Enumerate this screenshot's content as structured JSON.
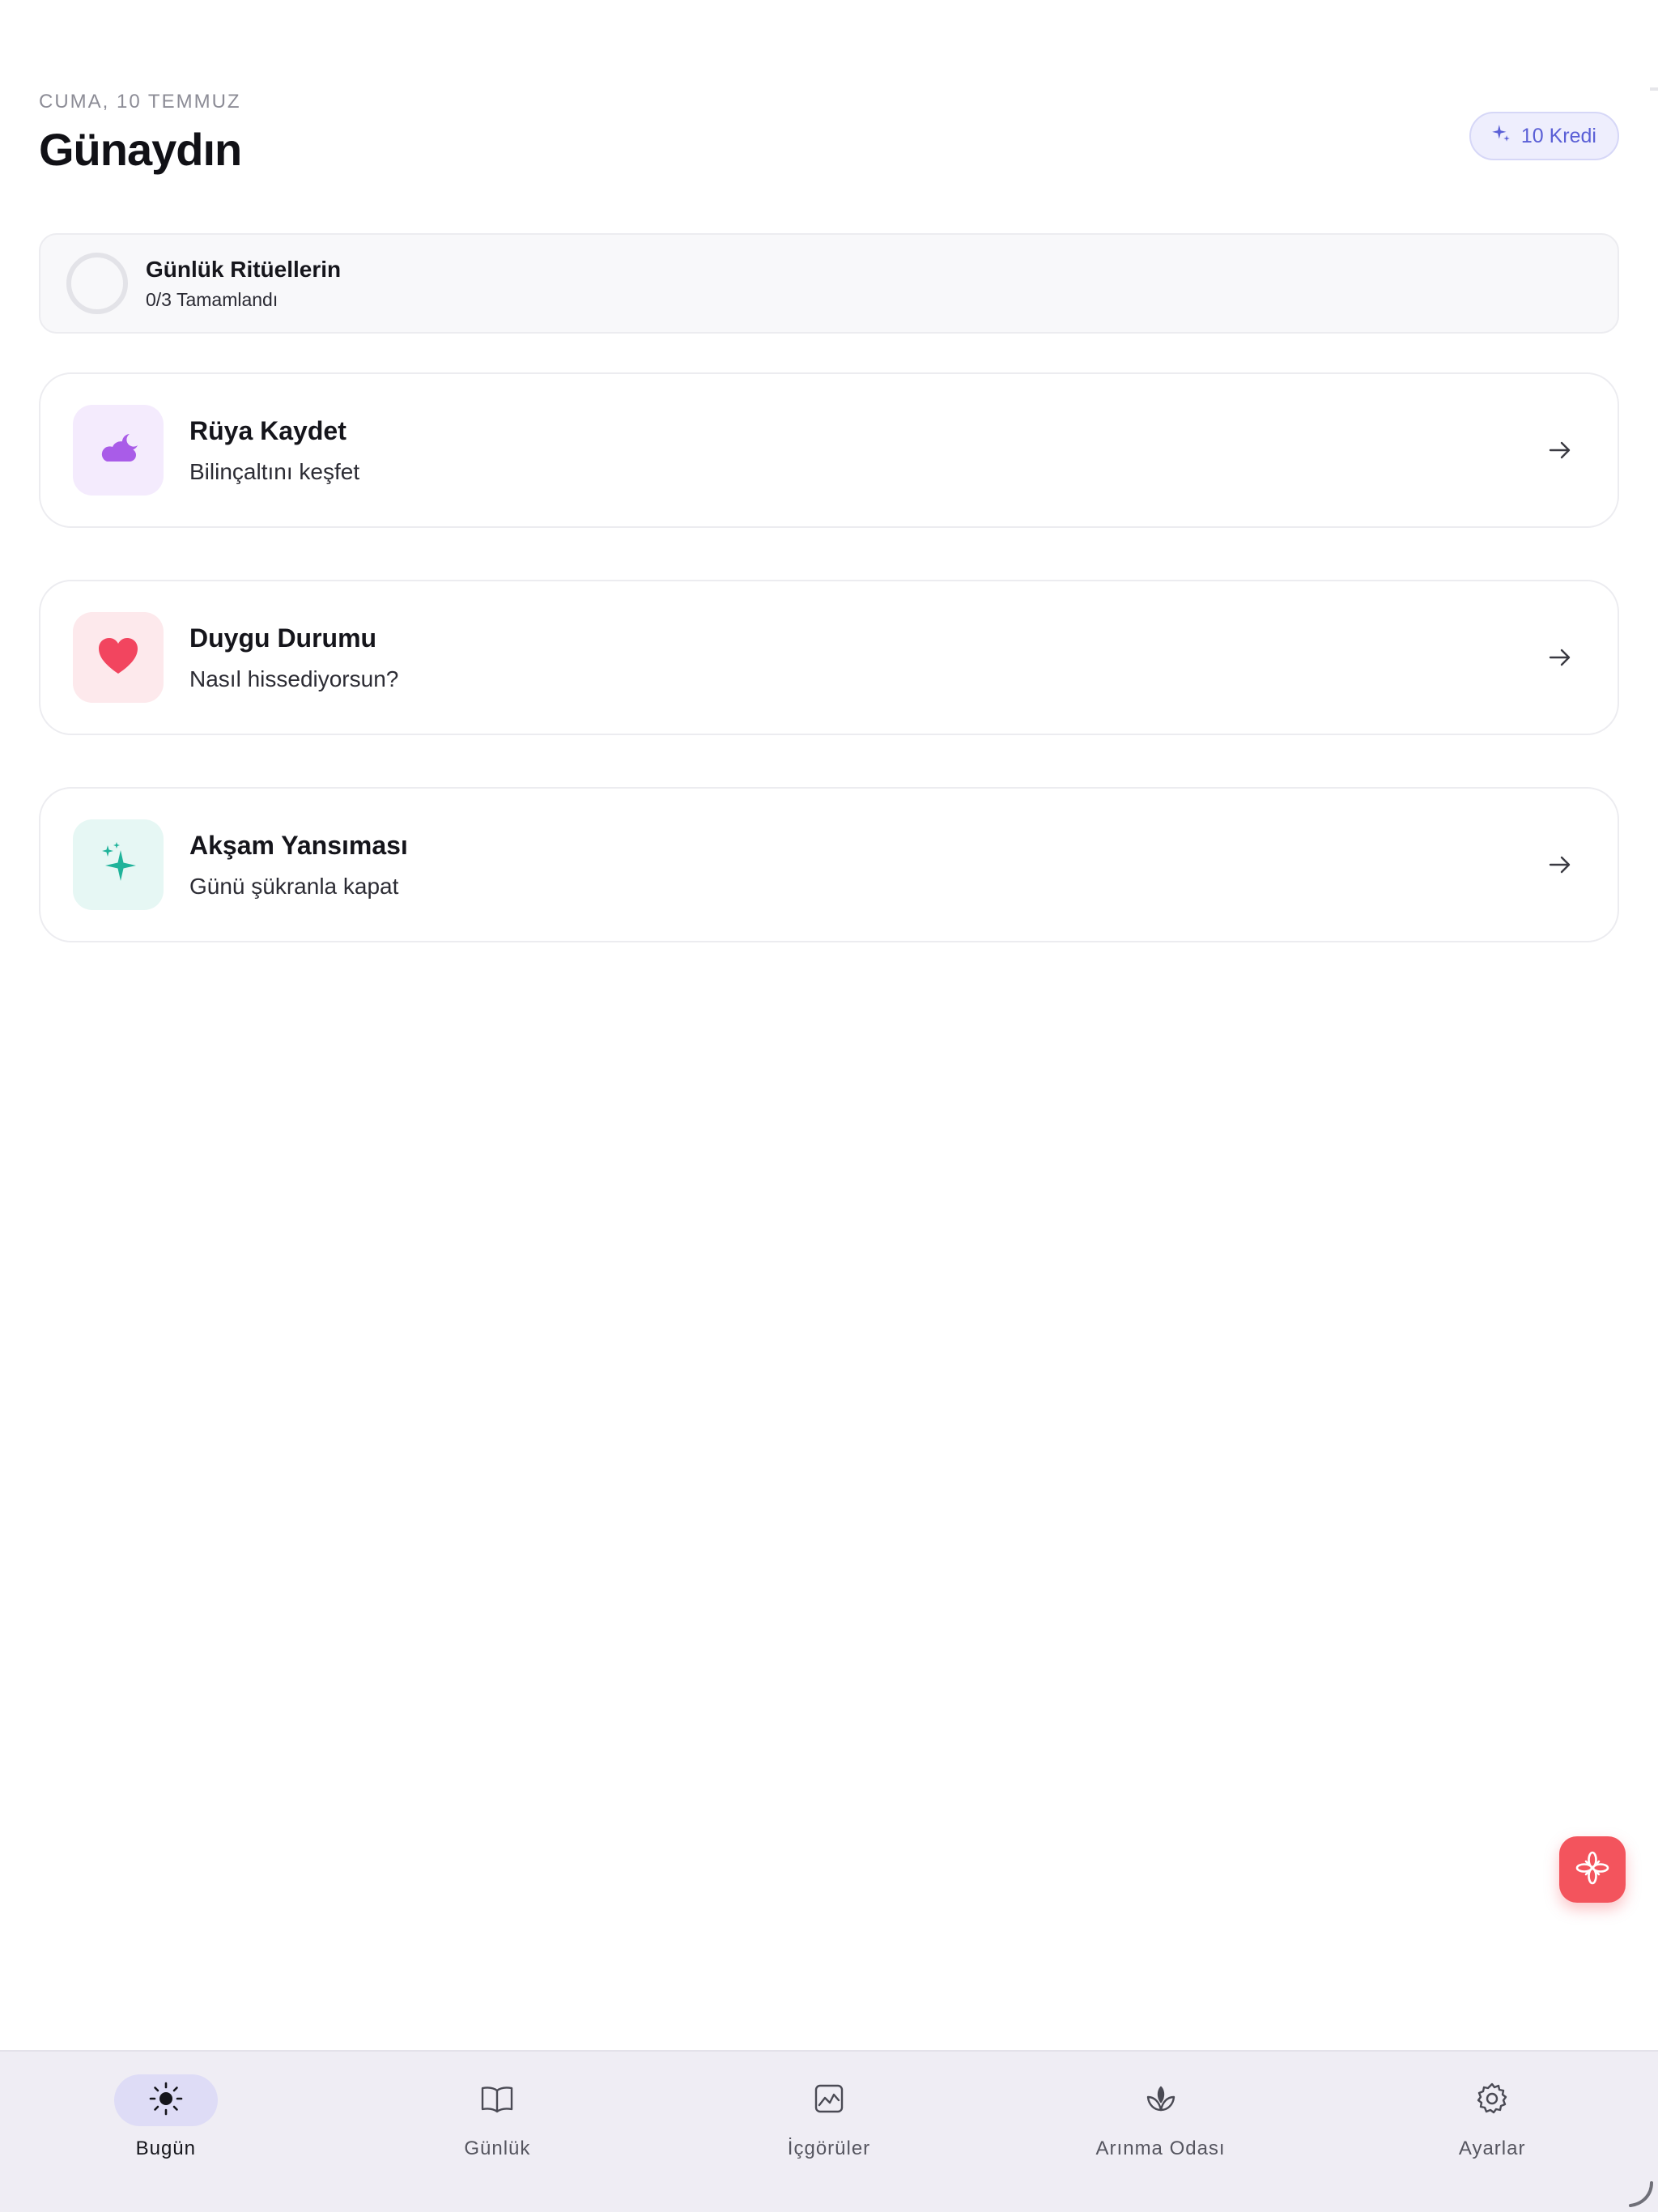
{
  "header": {
    "date": "CUMA, 10 TEMMUZ",
    "greeting": "Günaydın",
    "credits_label": "10 Kredi",
    "credits_icon": "sparkle-icon"
  },
  "rituals": {
    "title": "Günlük Ritüellerin",
    "progress_text": "0/3 Tamamlandı",
    "completed": 0,
    "total": 3
  },
  "cards": [
    {
      "title": "Rüya Kaydet",
      "subtitle": "Bilinçaltını keşfet",
      "icon": "cloud-moon-icon",
      "icon_color": "#a95ce8",
      "icon_bg": "#f4ebfd"
    },
    {
      "title": "Duygu Durumu",
      "subtitle": "Nasıl hissediyorsun?",
      "icon": "heart-icon",
      "icon_color": "#f2455f",
      "icon_bg": "#fde9ec"
    },
    {
      "title": "Akşam Yansıması",
      "subtitle": "Günü şükranla kapat",
      "icon": "sparkles-icon",
      "icon_color": "#1fb39a",
      "icon_bg": "#e6f7f4"
    }
  ],
  "fab": {
    "icon": "asterisk-flower-icon",
    "color": "#f3545d"
  },
  "nav": {
    "items": [
      {
        "label": "Bugün",
        "icon": "sun-icon",
        "active": true
      },
      {
        "label": "Günlük",
        "icon": "book-icon",
        "active": false
      },
      {
        "label": "İçgörüler",
        "icon": "chart-image-icon",
        "active": false
      },
      {
        "label": "Arınma Odası",
        "icon": "lotus-icon",
        "active": false
      },
      {
        "label": "Ayarlar",
        "icon": "gear-icon",
        "active": false
      }
    ]
  },
  "colors": {
    "accent": "#5a5fd6",
    "nav_bg": "#efedf4",
    "nav_active_bg": "#dedcf6"
  }
}
